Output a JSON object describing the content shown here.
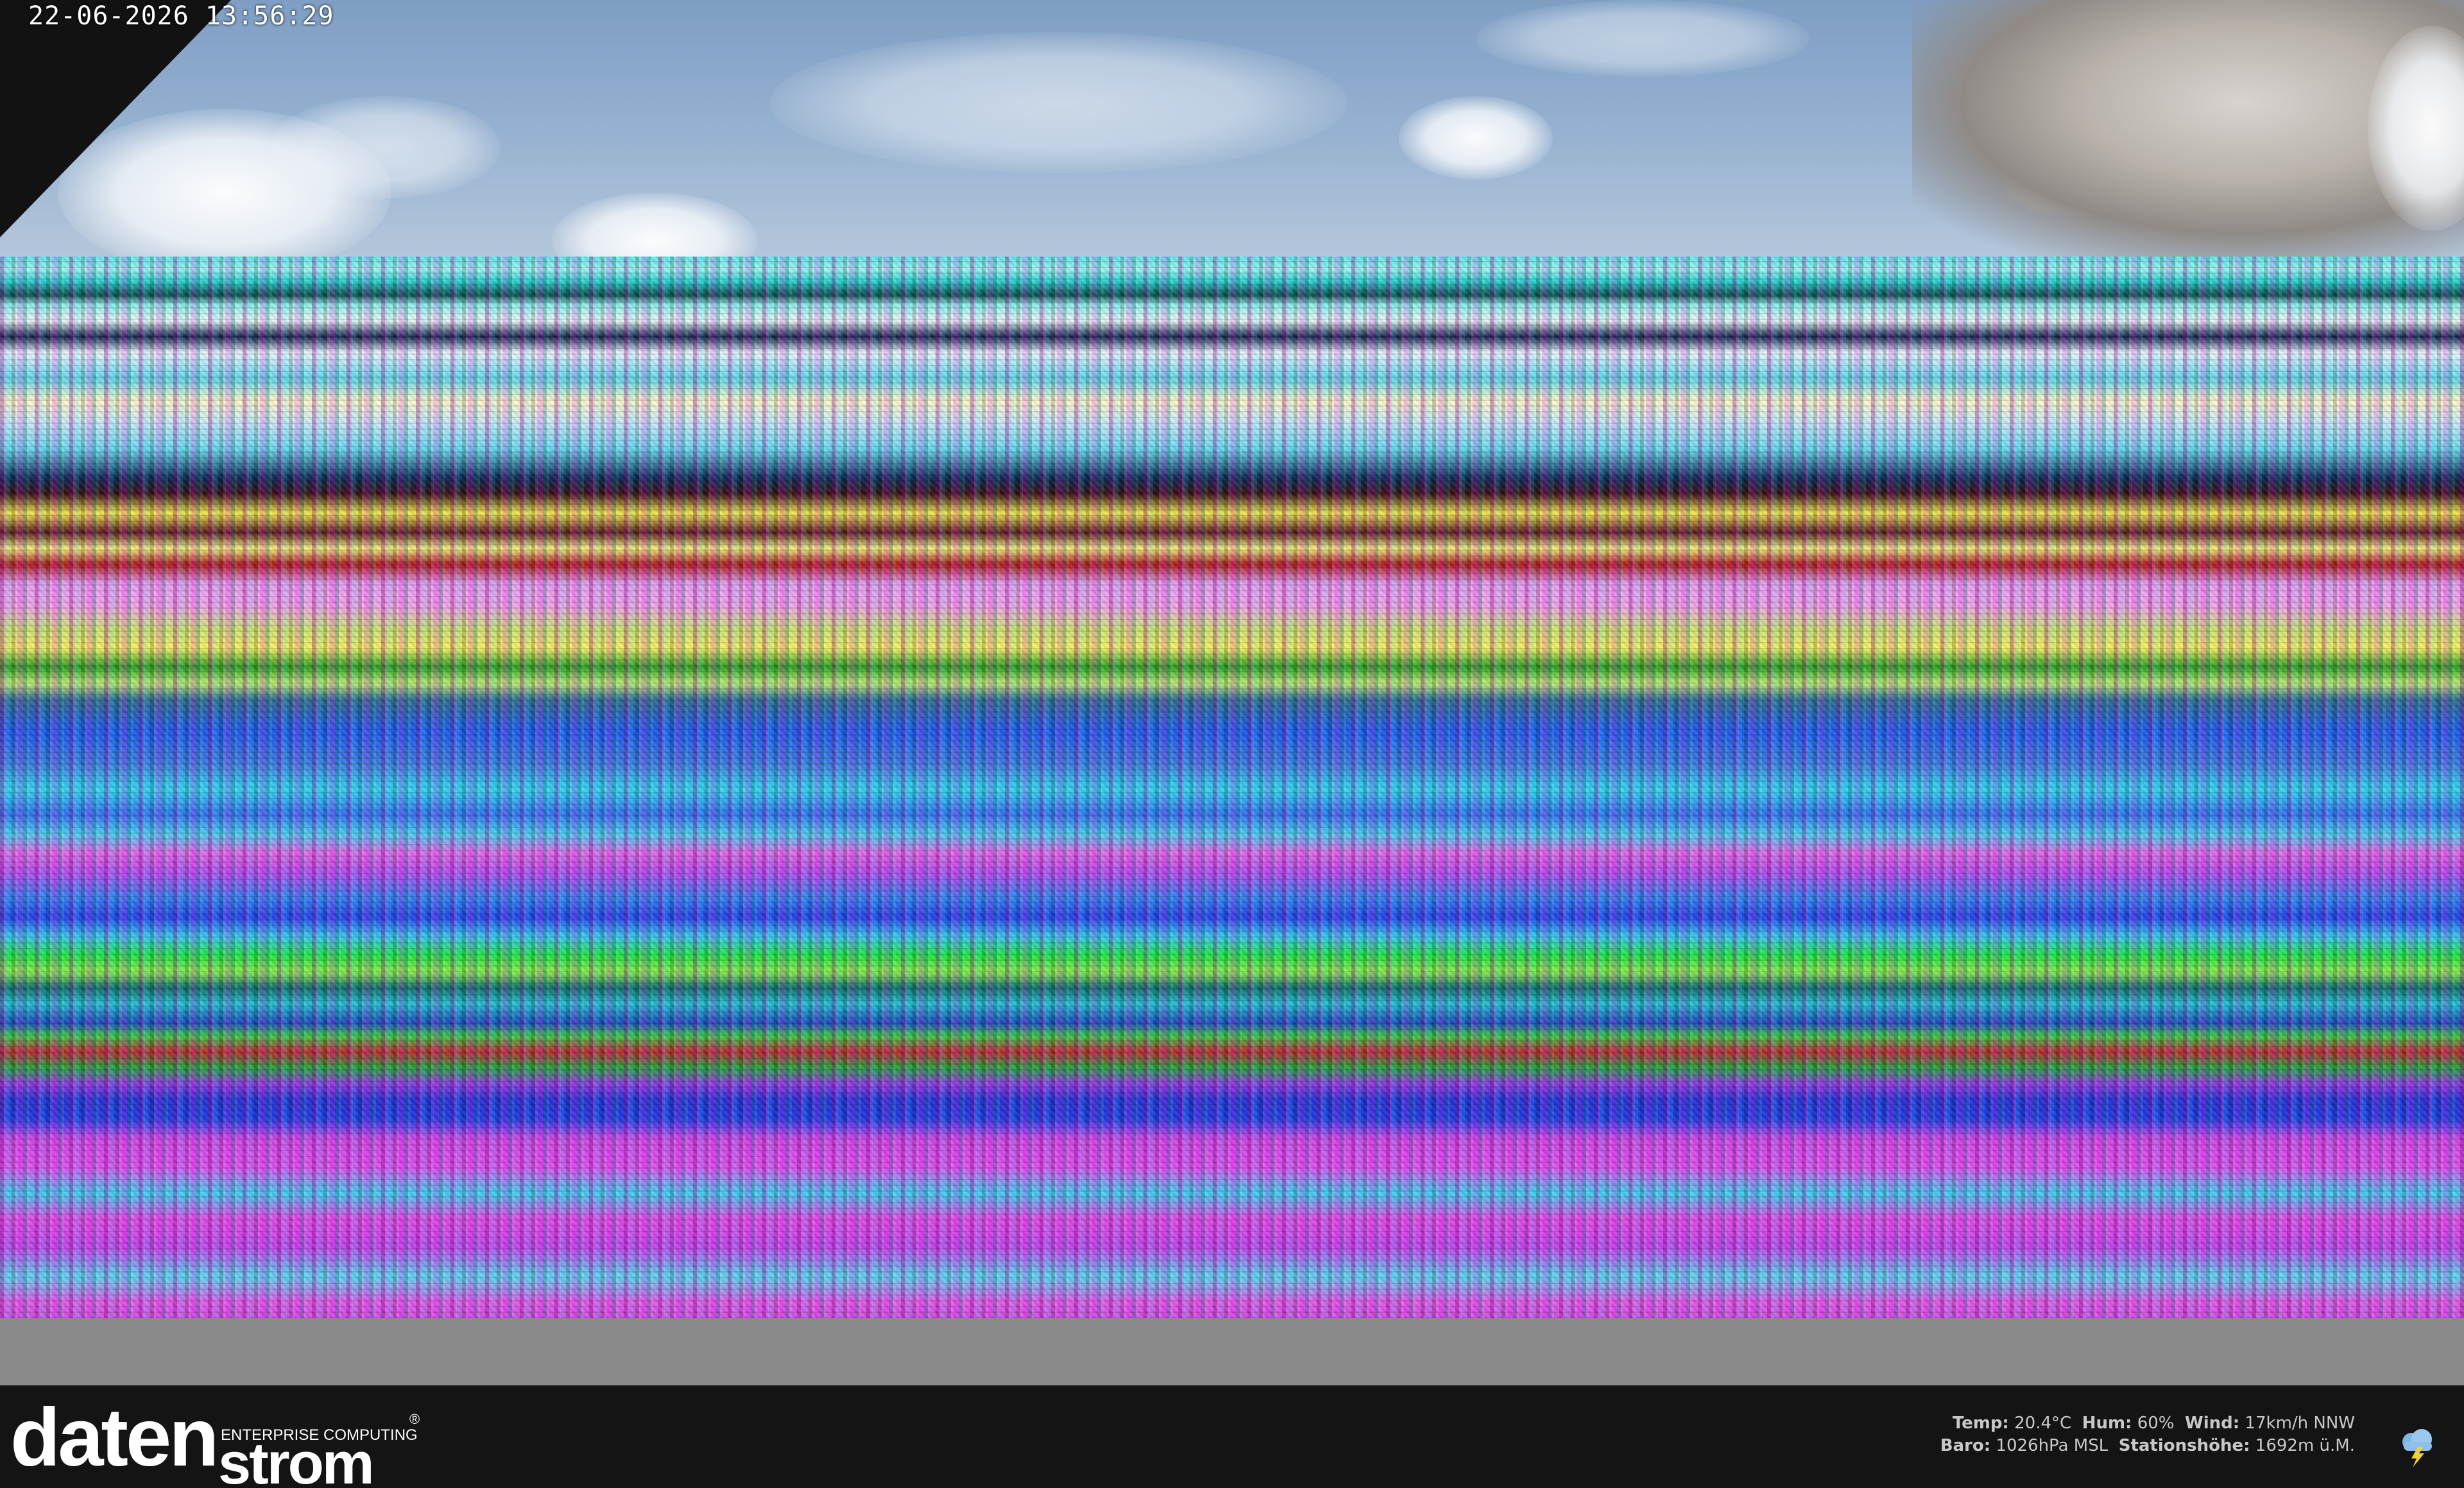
{
  "timestamp": "22-06-2026 13:56:29",
  "brand": {
    "word_top": "daten",
    "word_bottom": "strom",
    "tagline": "ENTERPRISE COMPUTING",
    "registered": "®"
  },
  "weather": {
    "temp_label": "Temp:",
    "temp_value": "20.4°C",
    "hum_label": "Hum:",
    "hum_value": "60%",
    "wind_label": "Wind:",
    "wind_value": "17km/h NNW",
    "baro_label": "Baro:",
    "baro_value": "1026hPa MSL",
    "station_label": "Stationshöhe:",
    "station_value": "1692m ü.M.",
    "icon": "thunderstorm-icon"
  },
  "colors": {
    "footer_bg": "#141414",
    "gray_band": "#8a8a8a",
    "sky": "#8fabcd"
  }
}
